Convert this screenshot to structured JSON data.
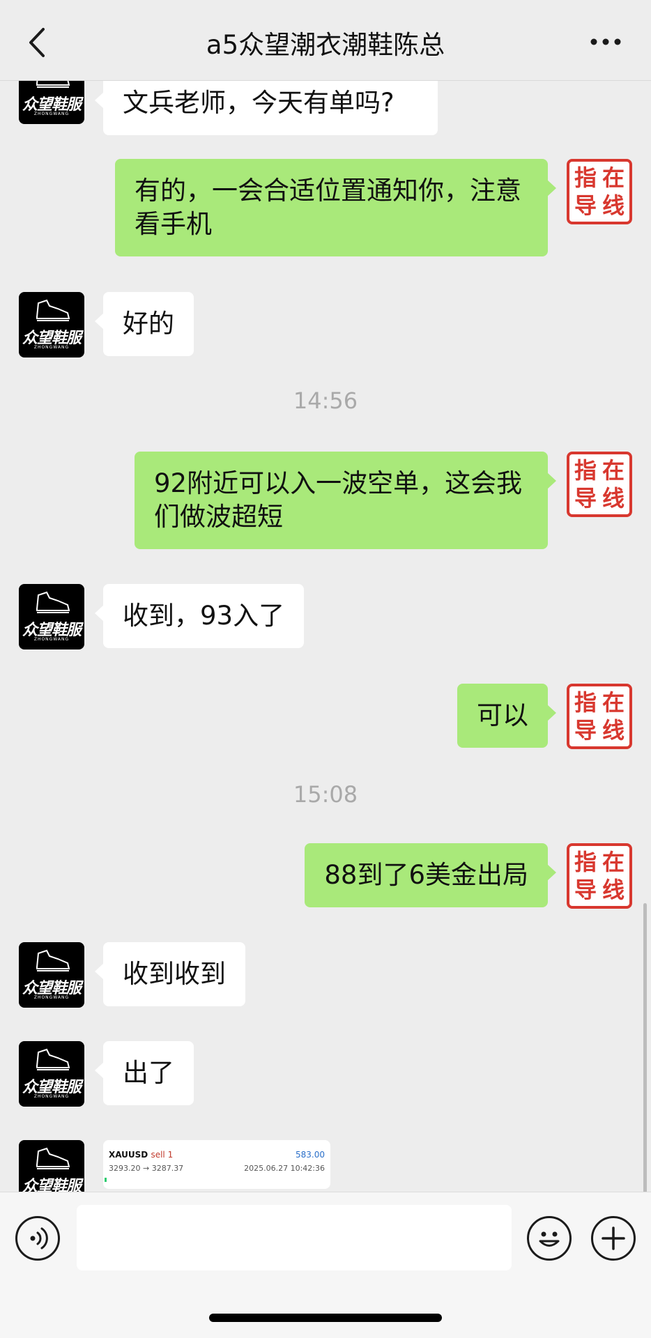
{
  "header": {
    "title": "a5众望潮衣潮鞋陈总",
    "back_icon": "chevron-left-icon",
    "more_icon": "more-dots-icon"
  },
  "contact_avatar": {
    "brand": "众望鞋服",
    "brand_sub": "ZHONGWANG"
  },
  "my_avatar": {
    "seal_chars": [
      "指",
      "在",
      "导",
      "线"
    ],
    "seal_color": "#d8382f"
  },
  "colors": {
    "outgoing_bubble": "#a9e97a",
    "incoming_bubble": "#ffffff",
    "background": "#ededed"
  },
  "messages": [
    {
      "side": "left",
      "text": "文兵老师，今天有单吗?"
    },
    {
      "side": "right",
      "text": "有的，一会合适位置通知你，注意看手机"
    },
    {
      "side": "left",
      "text": "好的"
    },
    {
      "type": "time",
      "text": "14:56"
    },
    {
      "side": "right",
      "text": "92附近可以入一波空单，这会我们做波超短"
    },
    {
      "side": "left",
      "text": "收到，93入了"
    },
    {
      "side": "right",
      "text": "可以"
    },
    {
      "type": "time",
      "text": "15:08"
    },
    {
      "side": "right",
      "text": "88到了6美金出局"
    },
    {
      "side": "left",
      "text": "收到收到"
    },
    {
      "side": "left",
      "text": "出了"
    }
  ],
  "trade_card": {
    "symbol": "XAUUSD",
    "direction": "sell 1",
    "profit": "583.00",
    "prices": "3293.20 → 3287.37",
    "datetime": "2025.06.27 10:42:36"
  },
  "input_bar": {
    "placeholder": "",
    "voice_icon": "voice-icon",
    "emoji_icon": "emoji-icon",
    "plus_icon": "plus-icon"
  }
}
